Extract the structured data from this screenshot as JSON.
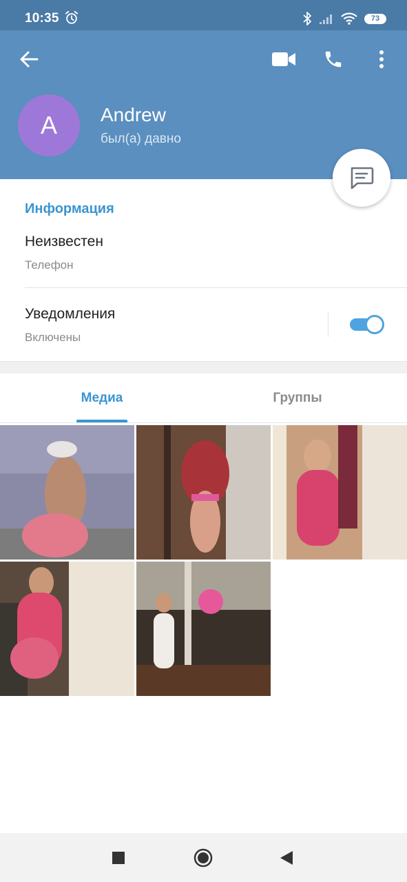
{
  "status_bar": {
    "time": "10:35",
    "battery": "73",
    "icons": [
      "alarm-icon",
      "bluetooth-icon",
      "signal-icon",
      "wifi-icon",
      "battery-icon"
    ]
  },
  "header": {
    "background_color": "#5a8fbf",
    "icons": [
      "back-arrow-icon",
      "video-call-icon",
      "phone-icon",
      "more-vertical-icon"
    ]
  },
  "profile": {
    "avatar_letter": "A",
    "avatar_color": "#9e78d8",
    "name": "Andrew",
    "status": "был(а) давно"
  },
  "fab": {
    "icon": "message-icon"
  },
  "info": {
    "title": "Информация",
    "phone_value": "Неизвестен",
    "phone_label": "Телефон",
    "notifications_title": "Уведомления",
    "notifications_state": "Включены",
    "notifications_enabled": true
  },
  "tabs": [
    {
      "label": "Медиа",
      "active": true
    },
    {
      "label": "Группы",
      "active": false
    }
  ],
  "media": {
    "count": 5,
    "items": [
      "photo-1",
      "photo-2",
      "photo-3",
      "photo-4",
      "photo-5"
    ]
  },
  "nav_bar": {
    "buttons": [
      "recents-square-icon",
      "home-circle-icon",
      "back-triangle-icon"
    ]
  },
  "colors": {
    "accent": "#3a95d2",
    "toggle_on": "#4fa3e0"
  }
}
